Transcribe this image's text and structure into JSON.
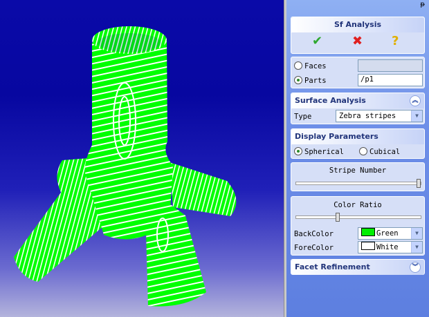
{
  "panel": {
    "pin_glyph": "ᵽ",
    "title": "Sf Analysis",
    "confirm_glyph": "✔",
    "cancel_glyph": "✖",
    "help_glyph": "?",
    "selection": {
      "faces_label": "Faces",
      "parts_label": "Parts",
      "faces_value": "",
      "parts_value": "/p1",
      "selected": "parts"
    },
    "surface_analysis": {
      "title": "Surface Analysis",
      "type_label": "Type",
      "type_value": "Zebra stripes",
      "collapse_glyph": "︽"
    },
    "display": {
      "title": "Display Parameters",
      "spherical_label": "Spherical",
      "cubical_label": "Cubical",
      "selected": "spherical",
      "stripe_number_label": "Stripe Number",
      "stripe_number_level": 1.0,
      "color_ratio_label": "Color Ratio",
      "color_ratio_level": 0.33,
      "back_color_label": "BackColor",
      "back_color_value": "Green",
      "back_color_hex": "#00ee00",
      "fore_color_label": "ForeColor",
      "fore_color_value": "White",
      "fore_color_hex": "#ffffff"
    },
    "facet_refinement": {
      "title": "Facet Refinement",
      "expand_glyph": "︾"
    }
  },
  "viewport": {
    "model_color": "#00ff00",
    "stripe_color": "#ffffff"
  }
}
